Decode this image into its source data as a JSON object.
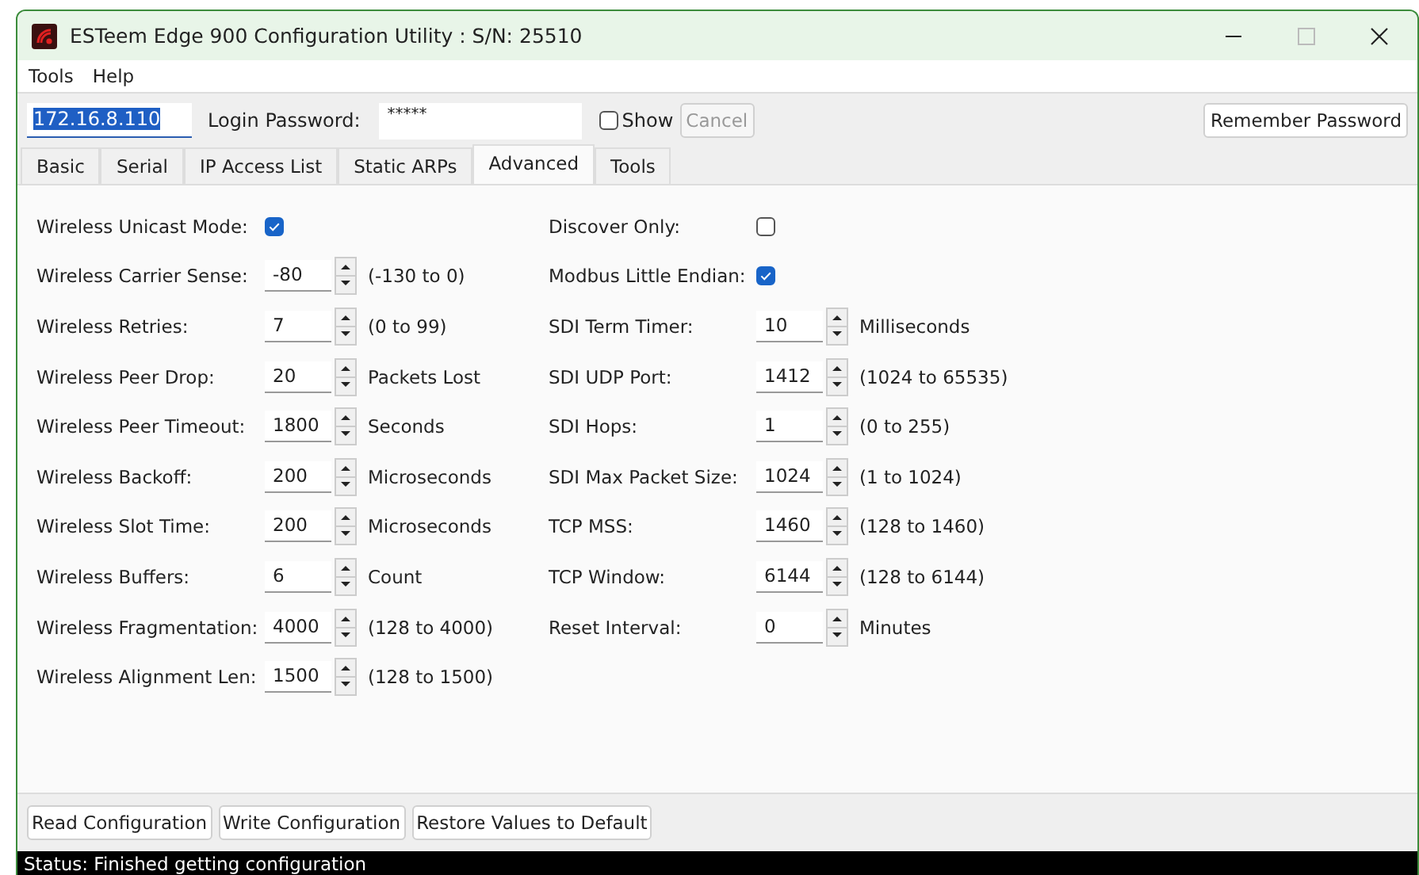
{
  "window": {
    "title": "ESTeem Edge 900 Configuration Utility : S/N: 25510"
  },
  "menu": [
    "Tools",
    "Help"
  ],
  "toolbar": {
    "address": "172.16.8.110",
    "address_selected": true,
    "password_label": "Login Password:",
    "password": "*****",
    "show": {
      "label": "Show",
      "checked": false
    },
    "cancel": {
      "label": "Cancel",
      "disabled": true
    },
    "remember": "Remember Password"
  },
  "tabs": [
    {
      "label": "Basic",
      "selected": false
    },
    {
      "label": "Serial",
      "selected": false
    },
    {
      "label": "IP Access List",
      "selected": false
    },
    {
      "label": "Static ARPs",
      "selected": false
    },
    {
      "label": "Advanced",
      "selected": true
    },
    {
      "label": "Tools",
      "selected": false
    }
  ],
  "left_fields": [
    {
      "kind": "checkbox",
      "label": "Wireless Unicast Mode:",
      "checked": true
    },
    {
      "kind": "spin",
      "label": "Wireless Carrier Sense:",
      "value": "-80",
      "unit": "(-130 to 0)"
    },
    {
      "kind": "spin",
      "label": "Wireless Retries:",
      "value": "7",
      "unit": "(0 to 99)"
    },
    {
      "kind": "spin",
      "label": "Wireless Peer Drop:",
      "value": "20",
      "unit": "Packets Lost"
    },
    {
      "kind": "spin",
      "label": "Wireless Peer Timeout:",
      "value": "1800",
      "unit": "Seconds"
    },
    {
      "kind": "spin",
      "label": "Wireless Backoff:",
      "value": "200",
      "unit": "Microseconds"
    },
    {
      "kind": "spin",
      "label": "Wireless Slot Time:",
      "value": "200",
      "unit": "Microseconds"
    },
    {
      "kind": "spin",
      "label": "Wireless Buffers:",
      "value": "6",
      "unit": "Count"
    },
    {
      "kind": "spin",
      "label": "Wireless Fragmentation:",
      "value": "4000",
      "unit": "(128 to 4000)"
    },
    {
      "kind": "spin",
      "label": "Wireless Alignment Len:",
      "value": "1500",
      "unit": "(128 to 1500)"
    }
  ],
  "right_fields": [
    {
      "kind": "checkbox",
      "label": "Discover Only:",
      "checked": false
    },
    {
      "kind": "checkbox",
      "label": "Modbus Little Endian:",
      "checked": true
    },
    {
      "kind": "spin",
      "label": "SDI Term Timer:",
      "value": "10",
      "unit": "Milliseconds"
    },
    {
      "kind": "spin",
      "label": "SDI UDP Port:",
      "value": "1412",
      "unit": "(1024 to 65535)"
    },
    {
      "kind": "spin",
      "label": "SDI Hops:",
      "value": "1",
      "unit": "(0 to 255)"
    },
    {
      "kind": "spin",
      "label": "SDI Max Packet Size:",
      "value": "1024",
      "unit": "(1 to 1024)"
    },
    {
      "kind": "spin",
      "label": "TCP MSS:",
      "value": "1460",
      "unit": "(128 to 1460)"
    },
    {
      "kind": "spin",
      "label": "TCP Window:",
      "value": "6144",
      "unit": "(128 to 6144)"
    },
    {
      "kind": "spin",
      "label": "Reset Interval:",
      "value": "0",
      "unit": "Minutes"
    }
  ],
  "buttons": [
    "Read Configuration",
    "Write Configuration",
    "Restore Values to Default"
  ],
  "status_bar": "Status: Finished getting configuration"
}
